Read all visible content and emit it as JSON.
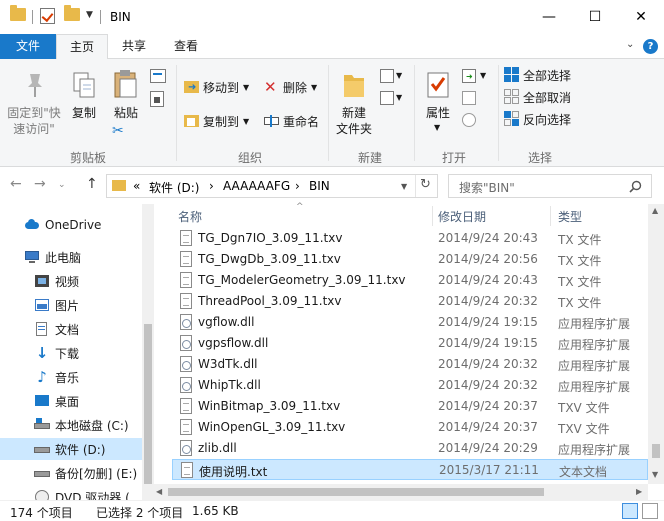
{
  "window": {
    "title": "BIN",
    "minimize": "—",
    "maximize": "☐",
    "close": "✕"
  },
  "tabs": {
    "file": "文件",
    "home": "主页",
    "share": "共享",
    "view": "查看",
    "expand": "⌄",
    "help": "?"
  },
  "ribbon": {
    "clipboard": {
      "label": "剪贴板",
      "pin_line1": "固定到\"快",
      "pin_line2": "速访问\"",
      "copy": "复制",
      "paste": "粘贴"
    },
    "organize": {
      "label": "组织",
      "move_to": "移动到",
      "copy_to": "复制到",
      "delete": "删除",
      "rename": "重命名"
    },
    "new": {
      "label": "新建",
      "new_folder_line1": "新建",
      "new_folder_line2": "文件夹"
    },
    "open": {
      "label": "打开",
      "properties": "属性"
    },
    "select": {
      "label": "选择",
      "select_all": "全部选择",
      "select_none": "全部取消",
      "invert": "反向选择"
    }
  },
  "address": {
    "overflow": "«",
    "crumbs": [
      "软件 (D:)",
      "AAAAAAFG",
      "BIN"
    ],
    "sep": "›",
    "search_placeholder": "搜索\"BIN\""
  },
  "nav": {
    "items": [
      {
        "label": "OneDrive",
        "icon": "cloud-icon"
      },
      {
        "label": "此电脑",
        "icon": "computer-icon"
      },
      {
        "label": "视频",
        "icon": "video-icon"
      },
      {
        "label": "图片",
        "icon": "picture-icon"
      },
      {
        "label": "文档",
        "icon": "document-icon"
      },
      {
        "label": "下载",
        "icon": "download-icon"
      },
      {
        "label": "音乐",
        "icon": "music-icon"
      },
      {
        "label": "桌面",
        "icon": "desktop-icon"
      },
      {
        "label": "本地磁盘 (C:)",
        "icon": "drive-icon"
      },
      {
        "label": "软件 (D:)",
        "icon": "drive-icon"
      },
      {
        "label": "备份[勿删] (E:)",
        "icon": "drive-icon"
      },
      {
        "label": "DVD 驱动器 (",
        "icon": "dvd-icon"
      }
    ]
  },
  "columns": {
    "name": "名称",
    "date": "修改日期",
    "type": "类型"
  },
  "files": [
    {
      "name": "TG_Dgn7IO_3.09_11.txv",
      "date": "2014/9/24 20:43",
      "type": "TX 文件",
      "kind": "txt"
    },
    {
      "name": "TG_DwgDb_3.09_11.txv",
      "date": "2014/9/24 20:56",
      "type": "TX 文件",
      "kind": "txt"
    },
    {
      "name": "TG_ModelerGeometry_3.09_11.txv",
      "date": "2014/9/24 20:43",
      "type": "TX 文件",
      "kind": "txt"
    },
    {
      "name": "ThreadPool_3.09_11.txv",
      "date": "2014/9/24 20:32",
      "type": "TX 文件",
      "kind": "txt"
    },
    {
      "name": "vgflow.dll",
      "date": "2014/9/24 19:15",
      "type": "应用程序扩展",
      "kind": "dll"
    },
    {
      "name": "vgpsflow.dll",
      "date": "2014/9/24 19:15",
      "type": "应用程序扩展",
      "kind": "dll"
    },
    {
      "name": "W3dTk.dll",
      "date": "2014/9/24 20:32",
      "type": "应用程序扩展",
      "kind": "dll"
    },
    {
      "name": "WhipTk.dll",
      "date": "2014/9/24 20:32",
      "type": "应用程序扩展",
      "kind": "dll"
    },
    {
      "name": "WinBitmap_3.09_11.txv",
      "date": "2014/9/24 20:37",
      "type": "TXV 文件",
      "kind": "txt"
    },
    {
      "name": "WinOpenGL_3.09_11.txv",
      "date": "2014/9/24 20:37",
      "type": "TXV 文件",
      "kind": "txt"
    },
    {
      "name": "zlib.dll",
      "date": "2014/9/24 20:29",
      "type": "应用程序扩展",
      "kind": "dll"
    },
    {
      "name": "使用说明.txt",
      "date": "2015/3/17 21:11",
      "type": "文本文档",
      "kind": "txt"
    }
  ],
  "status": {
    "count": "174 个项目",
    "selected": "已选择 2 个项目",
    "size": "1.65 KB"
  },
  "colors": {
    "accent": "#1979ca",
    "selection": "#cce8ff",
    "folder": "#e8b94a"
  }
}
